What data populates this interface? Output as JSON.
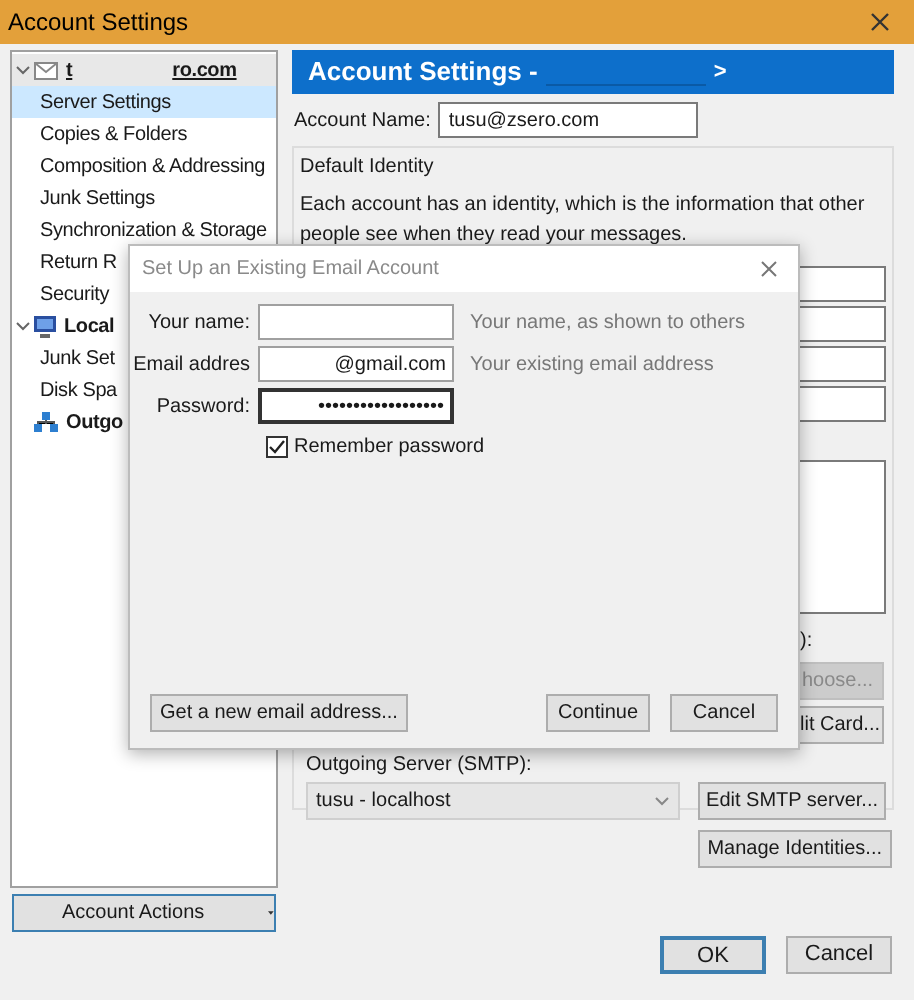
{
  "window": {
    "title": "Account Settings"
  },
  "tree": {
    "items": [
      {
        "kind": "account",
        "label": "t",
        "label_end": "ro.com",
        "selected": false,
        "expanded": true,
        "children": [
          {
            "label": "Server Settings",
            "selected": true
          },
          {
            "label": "Copies & Folders",
            "selected": false
          },
          {
            "label": "Composition & Addressing",
            "selected": false
          },
          {
            "label": "Junk Settings",
            "selected": false
          },
          {
            "label": "Synchronization & Storage",
            "selected": false
          },
          {
            "label": "Return R",
            "selected": false
          },
          {
            "label": "Security",
            "selected": false
          }
        ]
      },
      {
        "kind": "local",
        "label": "Local",
        "selected": false,
        "expanded": true,
        "children": [
          {
            "label": "Junk Set",
            "selected": false
          },
          {
            "label": "Disk Spa",
            "selected": false
          }
        ]
      },
      {
        "kind": "outgoing",
        "label": "Outgo",
        "selected": false
      }
    ]
  },
  "account_actions_button": "Account Actions",
  "panel": {
    "header_title": "Account Settings -",
    "header_suffix": ">",
    "account_name_label": "Account Name:",
    "account_name": "tusu@zsero.com",
    "identity": {
      "legend": "Default Identity",
      "description": "Each account has an identity, which is the information that other people see when they read your messages.",
      "signature_label_end": "):",
      "choose_button": {
        "label": "hoose...",
        "disabled": true
      },
      "edit_card_button": "lit Card...",
      "smtp_label": "Outgoing Server (SMTP):",
      "smtp_value": "tusu - localhost",
      "edit_smtp_button": "Edit SMTP server..."
    },
    "manage_identities_button": "Manage Identities..."
  },
  "buttons": [
    {
      "label": "OK",
      "default": true
    },
    {
      "label": "Cancel",
      "default": false
    }
  ],
  "dialog": {
    "title": "Set Up an Existing Email Account",
    "fields": [
      {
        "label": "Your name:",
        "hint": "Your name, as shown to others"
      },
      {
        "label": "Email addres",
        "value": "@gmail.com",
        "hint": "Your existing email address"
      },
      {
        "label": "Password:",
        "value": "••••••••••••••••••"
      }
    ],
    "remember": {
      "label": "Remember password",
      "checked": true
    },
    "buttons": [
      {
        "label": "Get a new email address..."
      },
      {
        "label": "Continue"
      },
      {
        "label": "Cancel"
      }
    ]
  }
}
